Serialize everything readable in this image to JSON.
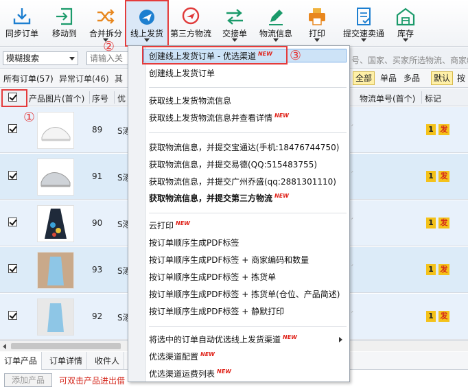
{
  "toolbar": {
    "buttons": [
      {
        "label": "同步订单",
        "icon": "download-icon"
      },
      {
        "label": "移动到",
        "icon": "move-icon"
      },
      {
        "label": "合并拆分",
        "icon": "shuffle-icon"
      },
      {
        "label": "线上发货",
        "icon": "plane-icon"
      },
      {
        "label": "第三方物流",
        "icon": "plane-circle-icon"
      },
      {
        "label": "交接单",
        "icon": "exchange-icon"
      },
      {
        "label": "物流信息",
        "icon": "pencil-icon"
      },
      {
        "label": "打印",
        "icon": "printer-icon"
      },
      {
        "label": "提交速卖通",
        "icon": "checklist-icon"
      },
      {
        "label": "库存",
        "icon": "warehouse-icon"
      }
    ]
  },
  "filter": {
    "mode": "模糊搜索",
    "placeholder": "请输入关",
    "hint": "号、国家、买家所选物流、商家编"
  },
  "order_tabs": [
    {
      "label": "所有订单(57)"
    },
    {
      "label": "异常订单(46)"
    },
    {
      "label": "其"
    }
  ],
  "segments": {
    "all": "全部",
    "single": "单品",
    "multi": "多品",
    "default": "默认",
    "more": "按"
  },
  "table": {
    "headers": {
      "image": "产品图片(首个)",
      "seq": "序号",
      "col3": "优",
      "tracking": "物流单号(首个)",
      "mark": "标记"
    },
    "rows": [
      {
        "seq": "89",
        "sku": "S涿",
        "mark1": "1",
        "mark2": "发"
      },
      {
        "seq": "91",
        "sku": "S涿",
        "mark1": "1",
        "mark2": "发"
      },
      {
        "seq": "90",
        "sku": "S涿",
        "mark1": "1",
        "mark2": "发"
      },
      {
        "seq": "93",
        "sku": "S涿",
        "mark1": "1",
        "mark2": "发"
      },
      {
        "seq": "92",
        "sku": "S涿",
        "mark1": "1",
        "mark2": "发"
      }
    ]
  },
  "bottom_tabs": [
    {
      "label": "订单产品"
    },
    {
      "label": "订单详情"
    },
    {
      "label": "收件人"
    }
  ],
  "bottom_bar": {
    "add_product": "添加产品",
    "drag_hint": "可双击产品进出借"
  },
  "menu": {
    "new_badge": "NEW",
    "items": [
      {
        "label": "创建线上发货订单 - 优选渠道",
        "new": true
      },
      {
        "label": "创建线上发货订单",
        "new": false
      },
      {
        "label": "获取线上发货物流信息",
        "new": false
      },
      {
        "label": "获取线上发货物流信息并查看详情",
        "new": true
      },
      {
        "label": "获取物流信息，并提交宝通达(手机:18476744750)",
        "new": false
      },
      {
        "label": "获取物流信息，并提交易德(QQ:515483755)",
        "new": false
      },
      {
        "label": "获取物流信息，并提交广州乔盛(qq:2881301110)",
        "new": false
      },
      {
        "label": "获取物流信息，并提交第三方物流",
        "new": true
      },
      {
        "label": "云打印",
        "new": true
      },
      {
        "label": "按订单顺序生成PDF标签",
        "new": false
      },
      {
        "label": "按订单顺序生成PDF标签 + 商家编码和数量",
        "new": false
      },
      {
        "label": "按订单顺序生成PDF标签 + 拣货单",
        "new": false
      },
      {
        "label": "按订单顺序生成PDF标签 + 拣货单(仓位、产品简述)",
        "new": false
      },
      {
        "label": "按订单顺序生成PDF标签 + 静默打印",
        "new": false
      },
      {
        "label": "将选中的订单自动优选线上发货渠道",
        "new": true
      },
      {
        "label": "优选渠道配置",
        "new": true
      },
      {
        "label": "优选渠道运费列表",
        "new": true
      }
    ]
  },
  "callouts": {
    "one": "①",
    "two": "②",
    "three": "③"
  },
  "colors": {
    "highlight_border": "#e43b3b",
    "new_badge": "#e0241b",
    "mark_yellow": "#f4c21a",
    "row_blue": "#dcebf8"
  }
}
